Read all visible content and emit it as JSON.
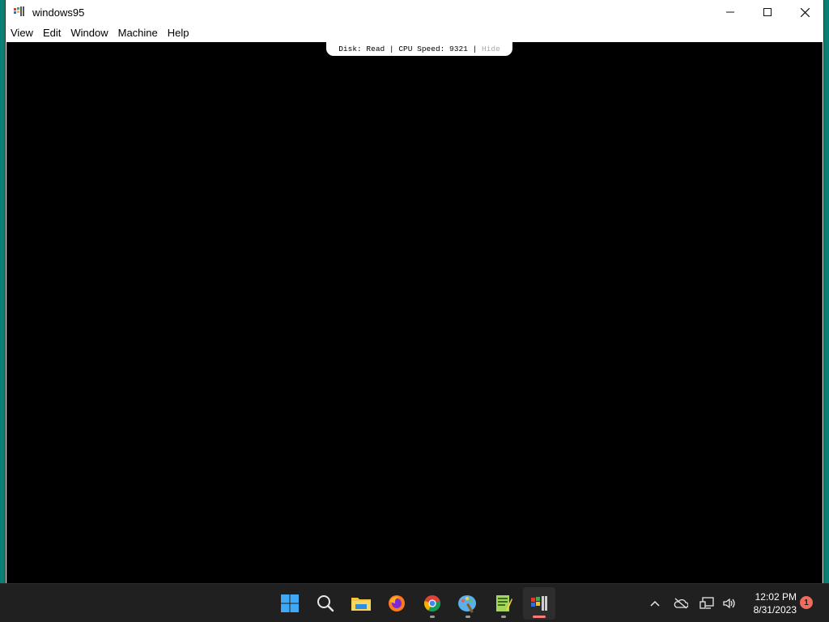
{
  "window": {
    "title": "windows95",
    "controls": {
      "minimize": "─",
      "maximize": "☐",
      "close": "✕"
    }
  },
  "menu": {
    "items": [
      "View",
      "Edit",
      "Window",
      "Machine",
      "Help"
    ]
  },
  "status": {
    "disk": "Disk: Read",
    "separator": " | ",
    "cpu": "CPU Speed: 9321",
    "hide": "Hide"
  },
  "taskbar": {
    "apps": [
      {
        "name": "start",
        "icon": "windows-start-icon"
      },
      {
        "name": "search",
        "icon": "search-icon"
      },
      {
        "name": "file-explorer",
        "icon": "folder-icon"
      },
      {
        "name": "firefox",
        "icon": "firefox-icon"
      },
      {
        "name": "chrome",
        "icon": "chrome-icon"
      },
      {
        "name": "paint",
        "icon": "paint-icon"
      },
      {
        "name": "notepad-plus",
        "icon": "notepad-icon"
      },
      {
        "name": "windows95",
        "icon": "windows95-icon"
      }
    ],
    "tray": {
      "icons": [
        "chevron-up-icon",
        "onedrive-icon",
        "network-icon",
        "volume-icon"
      ],
      "time": "12:02 PM",
      "date": "8/31/2023",
      "notification_count": "1"
    }
  }
}
